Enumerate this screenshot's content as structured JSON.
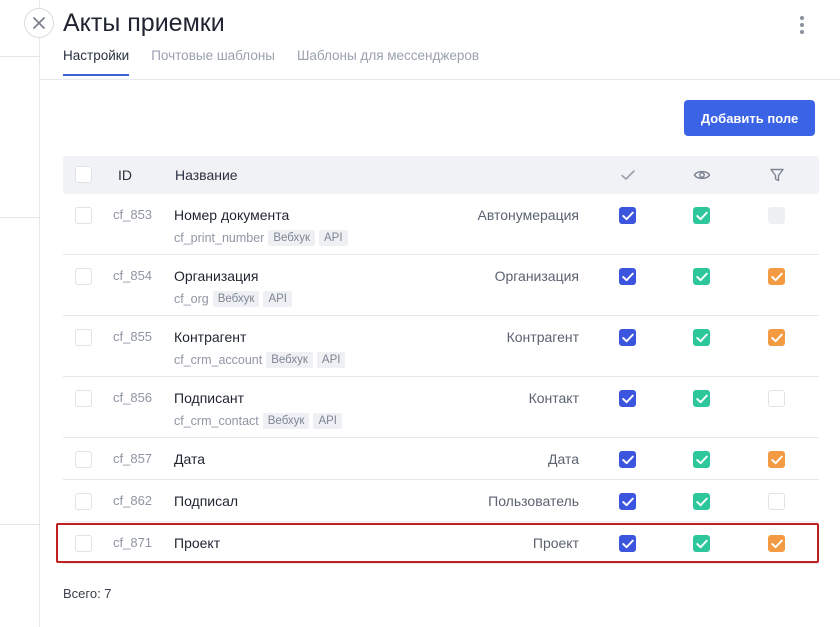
{
  "header": {
    "title": "Акты приемки",
    "tabs": [
      {
        "label": "Настройки",
        "active": true
      },
      {
        "label": "Почтовые шаблоны",
        "active": false
      },
      {
        "label": "Шаблоны для мессенджеров",
        "active": false
      }
    ]
  },
  "actions": {
    "add_field_label": "Добавить поле"
  },
  "table": {
    "columns": {
      "id": "ID",
      "name": "Название",
      "required_icon": "check-icon",
      "visible_icon": "eye-icon",
      "filter_icon": "filter-icon"
    },
    "rows": [
      {
        "id": "cf_853",
        "name": "Номер документа",
        "type": "Автонумерация",
        "code": "cf_print_number",
        "badges": [
          "Вебхук",
          "API"
        ],
        "required": true,
        "visible": true,
        "filter": "disabled"
      },
      {
        "id": "cf_854",
        "name": "Организация",
        "type": "Организация",
        "code": "cf_org",
        "badges": [
          "Вебхук",
          "API"
        ],
        "required": true,
        "visible": true,
        "filter": "checked"
      },
      {
        "id": "cf_855",
        "name": "Контрагент",
        "type": "Контрагент",
        "code": "cf_crm_account",
        "badges": [
          "Вебхук",
          "API"
        ],
        "required": true,
        "visible": true,
        "filter": "checked"
      },
      {
        "id": "cf_856",
        "name": "Подписант",
        "type": "Контакт",
        "code": "cf_crm_contact",
        "badges": [
          "Вебхук",
          "API"
        ],
        "required": true,
        "visible": true,
        "filter": "unchecked"
      },
      {
        "id": "cf_857",
        "name": "Дата",
        "type": "Дата",
        "code": "",
        "badges": [],
        "required": true,
        "visible": true,
        "filter": "checked"
      },
      {
        "id": "cf_862",
        "name": "Подписал",
        "type": "Пользователь",
        "code": "",
        "badges": [],
        "required": true,
        "visible": true,
        "filter": "unchecked"
      },
      {
        "id": "cf_871",
        "name": "Проект",
        "type": "Проект",
        "code": "",
        "badges": [],
        "required": true,
        "visible": true,
        "filter": "checked",
        "highlighted": true
      }
    ]
  },
  "footer": {
    "total": "Всего: 7"
  },
  "colors": {
    "accent": "#3b63e6",
    "required": "#3b55de",
    "visible": "#2ec79c",
    "filter": "#f29b43",
    "highlight": "#c01f1f"
  }
}
